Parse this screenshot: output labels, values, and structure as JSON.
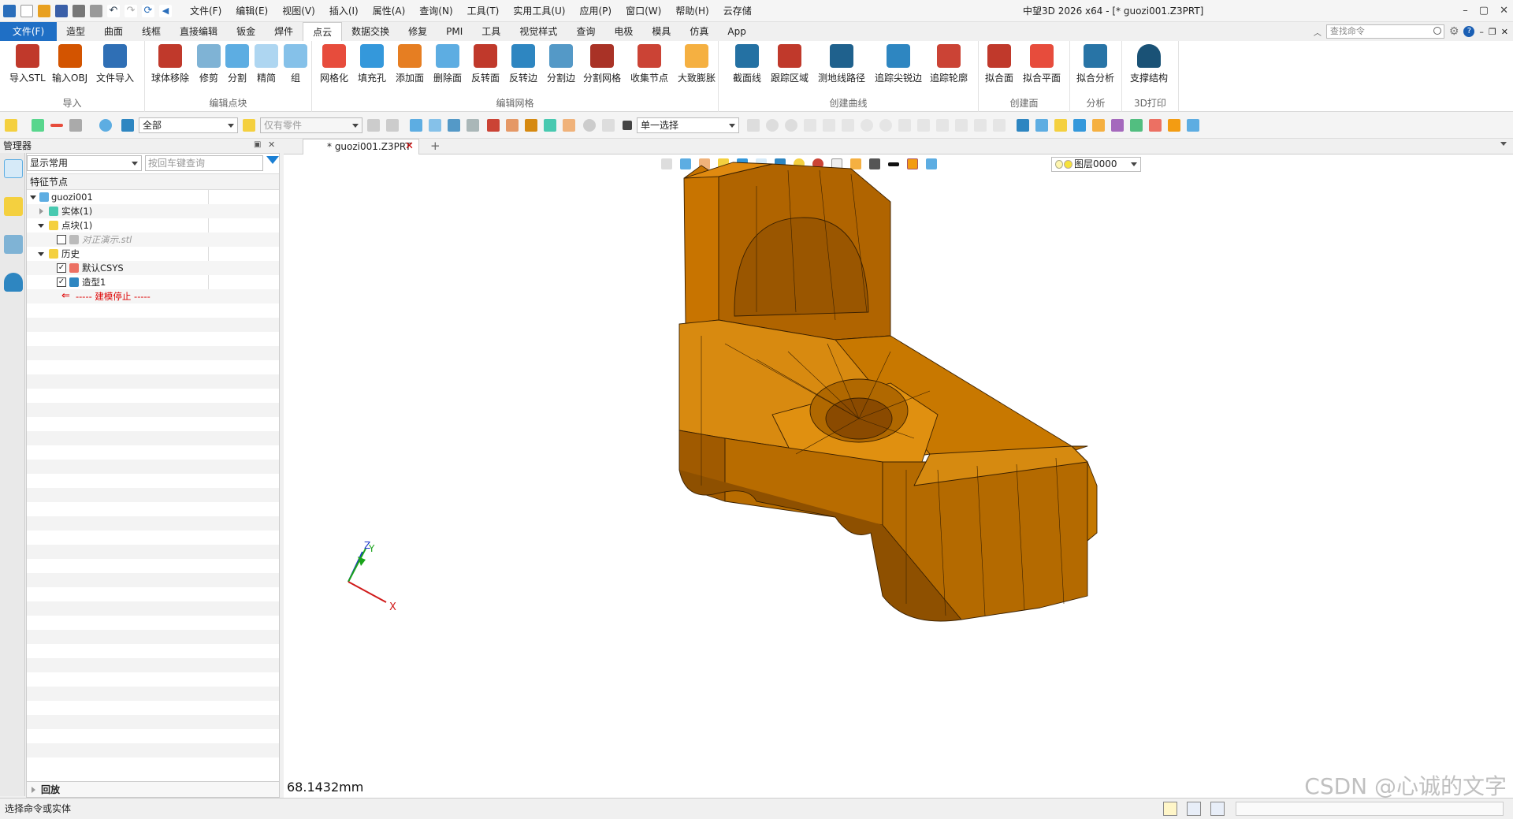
{
  "titlebar": {
    "menus": [
      "文件(F)",
      "编辑(E)",
      "视图(V)",
      "插入(I)",
      "属性(A)",
      "查询(N)",
      "工具(T)",
      "实用工具(U)",
      "应用(P)",
      "窗口(W)",
      "帮助(H)",
      "云存储"
    ],
    "title": "中望3D 2026 x64  - [* guozi001.Z3PRT]"
  },
  "ribbon_tabs": [
    "文件(F)",
    "造型",
    "曲面",
    "线框",
    "直接编辑",
    "钣金",
    "焊件",
    "点云",
    "数据交换",
    "修复",
    "PMI",
    "工具",
    "视觉样式",
    "查询",
    "电极",
    "模具",
    "仿真",
    "App"
  ],
  "active_tab": "点云",
  "search_command_placeholder": "查找命令",
  "ribbon": {
    "groups": [
      {
        "label": "导入",
        "buttons": [
          "导入STL",
          "输入OBJ",
          "文件导入"
        ]
      },
      {
        "label": "编辑点块",
        "buttons": [
          "球体移除",
          "修剪",
          "分割",
          "精简",
          "组"
        ]
      },
      {
        "label": "编辑网格",
        "buttons": [
          "网格化",
          "填充孔",
          "添加面",
          "删除面",
          "反转面",
          "反转边",
          "分割边",
          "分割网格",
          "收集节点",
          "大致膨胀"
        ]
      },
      {
        "label": "创建曲线",
        "buttons": [
          "截面线",
          "跟踪区域",
          "测地线路径",
          "追踪尖锐边",
          "追踪轮廓"
        ]
      },
      {
        "label": "创建面",
        "buttons": [
          "拟合面",
          "拟合平面"
        ]
      },
      {
        "label": "分析",
        "buttons": [
          "拟合分析"
        ]
      },
      {
        "label": "3D打印",
        "buttons": [
          "支撑结构"
        ]
      }
    ]
  },
  "toolbar": {
    "filter_value": "全部",
    "parts_value": "仅有零件",
    "select_mode": "单一选择"
  },
  "manager": {
    "title": "管理器",
    "display_filter": "显示常用",
    "search_placeholder": "按回车键查询",
    "feature_label": "特征节点",
    "tree": [
      {
        "label": "guozi001"
      },
      {
        "label": "实体(1)"
      },
      {
        "label": "点块(1)"
      },
      {
        "label": "对正演示.stl"
      },
      {
        "label": "历史"
      },
      {
        "label": "默认CSYS"
      },
      {
        "label": "造型1"
      },
      {
        "label": "----- 建模停止 -----"
      }
    ],
    "replay_label": "回放"
  },
  "document": {
    "tab_label": "* guozi001.Z3PRT",
    "layer": "图层0000",
    "measurement": "68.1432mm",
    "axes": {
      "x": "X",
      "y": "Y",
      "z": "Z"
    }
  },
  "watermark": "CSDN @心诚的文字",
  "status_text": "选择命令或实体",
  "colors": {
    "model": "#d27f06",
    "ribbon_tab_file": "#1f6fc5",
    "accent": "#1a7fd4"
  }
}
